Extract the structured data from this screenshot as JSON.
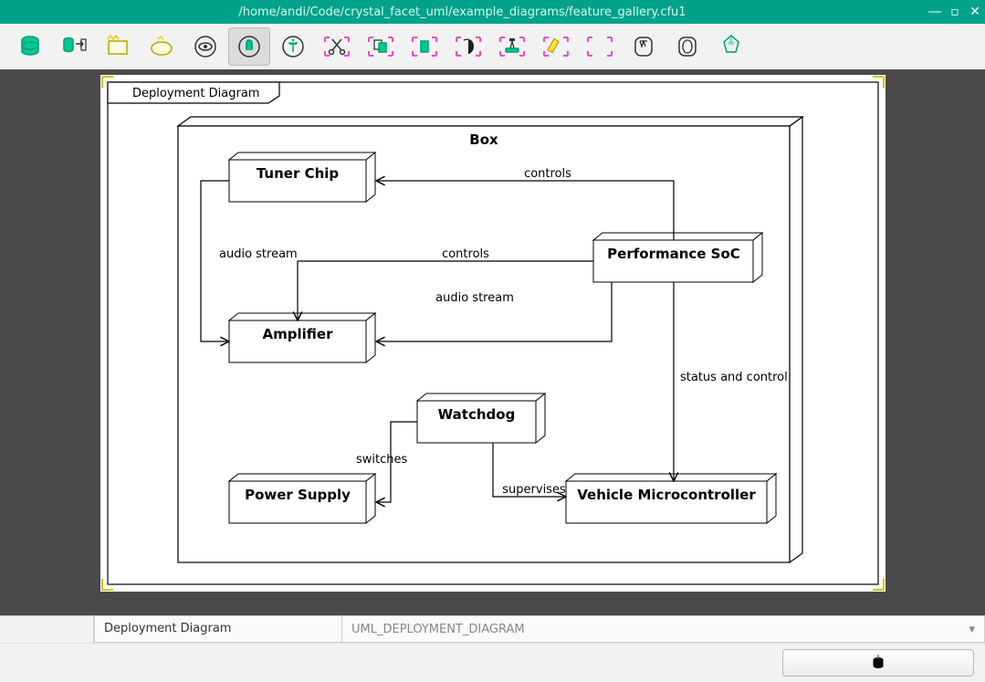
{
  "window": {
    "title": "/home/andi/Code/crystal_facet_uml/example_diagrams/feature_gallery.cfu1"
  },
  "toolbar_icons": [
    "database-icon",
    "export-icon",
    "new-window-icon",
    "new-diagram-icon",
    "view-icon",
    "edit-icon",
    "create-icon",
    "cut-icon",
    "copy-icon",
    "paste-icon",
    "delete-icon",
    "instantiate-icon",
    "highlight-icon",
    "reset-icon",
    "undo-icon",
    "redo-icon",
    "about-icon"
  ],
  "diagram": {
    "tab_label": "Deployment Diagram",
    "container_title": "Box",
    "nodes": {
      "tuner": {
        "label": "Tuner Chip"
      },
      "amplifier": {
        "label": "Amplifier"
      },
      "watchdog": {
        "label": "Watchdog"
      },
      "power_supply": {
        "label": "Power Supply"
      },
      "soc": {
        "label": "Performance SoC"
      },
      "vmc": {
        "label": "Vehicle Microcontroller"
      }
    },
    "edges": {
      "e1": {
        "label": "controls"
      },
      "e2": {
        "label": "controls"
      },
      "e3": {
        "label": "audio stream"
      },
      "e4": {
        "label": "audio stream"
      },
      "e5": {
        "label": "switches"
      },
      "e6": {
        "label": "supervises"
      },
      "e7": {
        "label": "status and control"
      }
    }
  },
  "footer": {
    "name_field": "Deployment Diagram",
    "type_field": "UML_DEPLOYMENT_DIAGRAM"
  }
}
